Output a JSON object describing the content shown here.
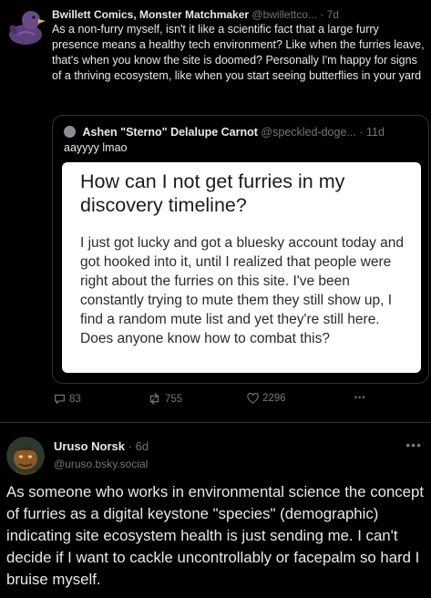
{
  "tweet": {
    "author_name": "Bwillett Comics, Monster Matchmaker",
    "author_handle": "@bwillettco...",
    "time": "· 7d",
    "body": "As a non-furry myself, isn't it like a scientific fact that a large furry presence means a healthy tech environment? Like when the furries leave, that's when you know the site is doomed? Personally I'm happy for signs of a thriving ecosystem, like when you start seeing butterflies in your yard",
    "quote": {
      "author_name": "Ashen \"Sterno\" Delalupe Carnot",
      "author_handle": "@speckled-doge...",
      "time": "· 11d",
      "text": "aayyyy lmao",
      "card": {
        "title": "How can I not get furries in my discovery timeline?",
        "body": "I just got lucky and got a bluesky account today and got hooked into it, until I realized that people were right about the furries on this site. I've been constantly trying to mute them they still show up, I find a random mute list and yet they're still here. Does anyone know how to combat this?"
      }
    },
    "actions": {
      "reply_count": "83",
      "repost_count": "755",
      "like_count": "2296",
      "more": "•••"
    }
  },
  "reply": {
    "author_name": "Uruso Norsk",
    "time": "· 6d",
    "handle": "@uruso.bsky.social",
    "more": "•••",
    "body": "As someone who works in environmental science the concept of furries as a digital keystone \"species\" (demographic) indicating site ecosystem health is just sending me. I can't decide if I want to cackle uncontrollably or facepalm so hard I bruise myself."
  },
  "icons": [
    "duck-avatar-icon",
    "reply-icon",
    "repost-icon",
    "like-icon",
    "more-icon",
    "user-avatar-icon"
  ],
  "colors": {
    "background": "#000000",
    "text": "#e7e9ea",
    "muted": "#71767b",
    "border": "#2f3336",
    "avatar_duck": "#6a4a8c"
  }
}
